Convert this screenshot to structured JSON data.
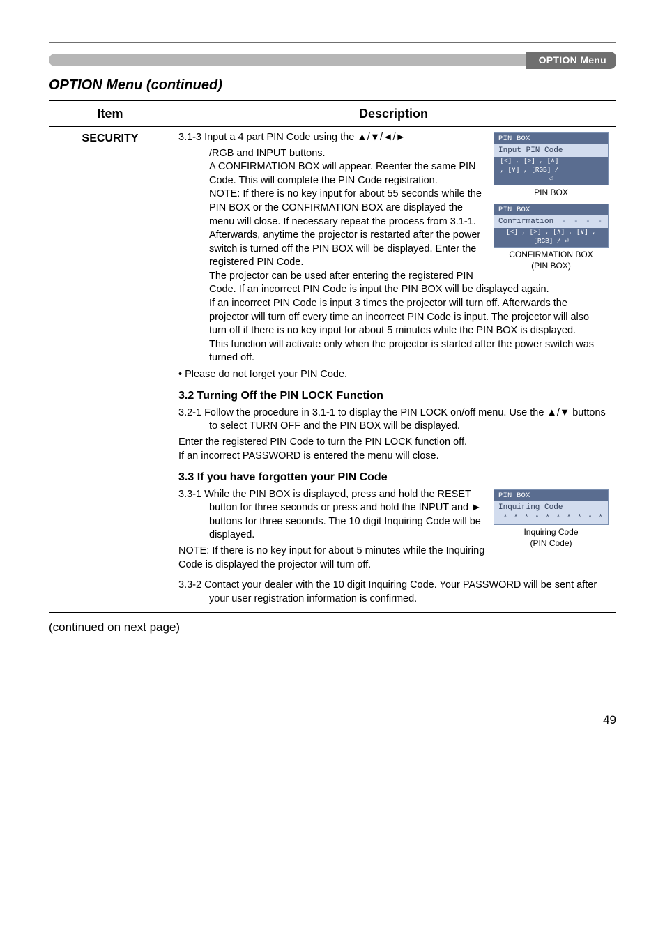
{
  "header": {
    "section": "OPTION Menu"
  },
  "title": "OPTION Menu (continued)",
  "table": {
    "headers": {
      "item": "Item",
      "description": "Description"
    },
    "item": "SECURITY",
    "p313": {
      "l1": "3.1-3  Input a 4 part PIN Code using the ▲/▼/◄/►",
      "l2": "/RGB and INPUT buttons.",
      "l3": "A CONFIRMATION BOX will appear. Reenter the same PIN Code. This will complete the PIN Code registration.",
      "l4": "NOTE: If there is no key input for about 55 seconds while the PIN BOX or the CONFIRMATION BOX are displayed the menu will close. If necessary repeat the process from 3.1-1.",
      "l5": "Afterwards, anytime the projector is restarted after the power switch is turned off the PIN BOX will be displayed. Enter the registered PIN Code.",
      "l6": "The projector can be used after entering the registered PIN Code. If an incorrect PIN Code is input the PIN BOX will be displayed again.",
      "l7": "If an incorrect PIN Code is input 3 times the projector will turn off. Afterwards the projector will turn off every time an incorrect PIN Code is input. The projector will also turn off if there is no key input for about 5 minutes while the PIN BOX is displayed.",
      "l8": "This function will activate only when the projector is started after the power switch was turned off.",
      "bullet": "• Please do not forget your PIN Code."
    },
    "s32": {
      "head": "3.2 Turning Off the PIN LOCK Function",
      "l1": "3.2-1 Follow the procedure in 3.1-1 to display the PIN LOCK on/off menu. Use the ▲/▼ buttons to select TURN OFF and the PIN BOX will be displayed.",
      "l2": "Enter the registered PIN Code to turn the PIN LOCK function off.",
      "l3": "If an incorrect PASSWORD is entered the  menu will close."
    },
    "s33": {
      "head": "3.3 If you have forgotten your PIN Code",
      "l1": "3.3-1 While the PIN BOX is displayed, press and hold the RESET button for three seconds or press and hold the INPUT and ► buttons for three seconds. The 10 digit Inquiring Code will be displayed.",
      "l2": "NOTE: If there is no key input for about 5 minutes while the Inquiring Code is displayed the projector will turn off.",
      "l3": "3.3-2 Contact your dealer with the 10 digit Inquiring Code. Your PASSWORD will be sent after your user registration information is confirmed."
    }
  },
  "boxes": {
    "pin": {
      "title": "PIN BOX",
      "line": "Input PIN Code",
      "dashes": "- - - -",
      "foot": "[<] , [>] , [∧] , [∨] , [RGB] / ⏎",
      "caption": "PIN BOX"
    },
    "conf": {
      "title": "PIN BOX",
      "line": "Confirmation",
      "dashes": "- - - -",
      "foot": "[<] , [>] , [∧] , [∨] , [RGB] / ⏎",
      "caption1": "CONFIRMATION BOX",
      "caption2": "(PIN BOX)"
    },
    "inq": {
      "title": "PIN BOX",
      "line": "Inquiring Code",
      "stars": "* *  * * * *  * * * *",
      "caption1": "Inquiring Code",
      "caption2": "(PIN Code)"
    }
  },
  "continued": "(continued on next page)",
  "page": "49"
}
